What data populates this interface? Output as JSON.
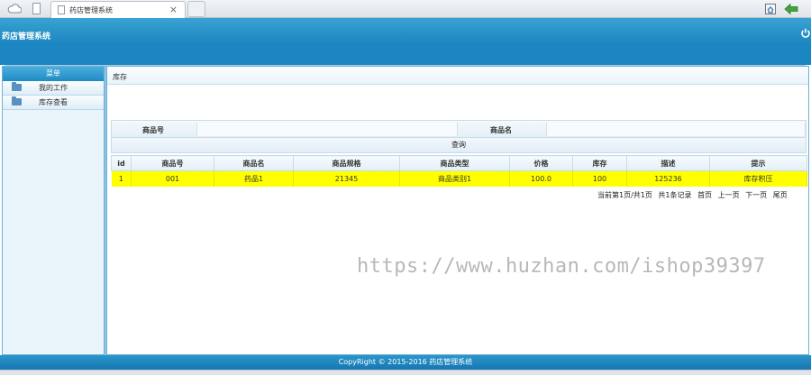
{
  "browser": {
    "tab_title": "药店管理系统",
    "tab_close": "×"
  },
  "app": {
    "title": "药店管理系统"
  },
  "sidebar": {
    "header": "菜单",
    "items": [
      {
        "label": "我的工作"
      },
      {
        "label": "库存查看"
      }
    ]
  },
  "main": {
    "breadcrumb": "库存",
    "search": {
      "product_no_label": "商品号",
      "product_name_label": "商品名",
      "query_button": "查询"
    },
    "table": {
      "headers": [
        "id",
        "商品号",
        "商品名",
        "商品规格",
        "商品类型",
        "价格",
        "库存",
        "描述",
        "提示"
      ],
      "rows": [
        [
          "1",
          "001",
          "药品1",
          "21345",
          "商品类别1",
          "100.0",
          "100",
          "125236",
          "库存积压"
        ]
      ]
    },
    "pager": {
      "status": "当前第1页/共1页",
      "total": "共1条记录",
      "first": "首页",
      "prev": "上一页",
      "next": "下一页",
      "last": "尾页"
    }
  },
  "watermark": "https://www.huzhan.com/ishop39397",
  "footer": "CopyRight © 2015-2016 药店管理系统",
  "colors": {
    "header_blue": "#1b86c1",
    "row_highlight": "#ffff00"
  }
}
